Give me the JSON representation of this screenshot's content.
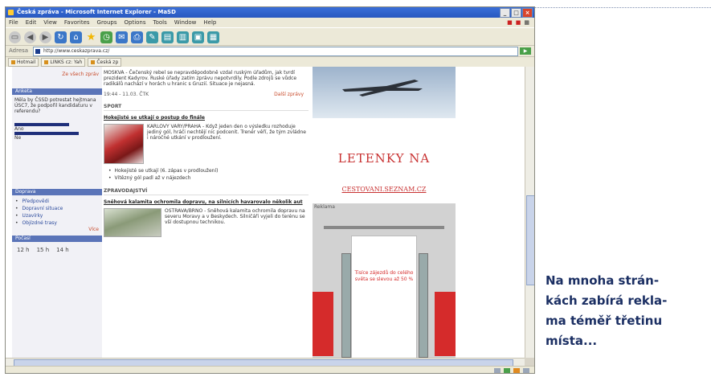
{
  "window": {
    "title": "Česká zpráva - Microsoft Internet Explorer - MaSD",
    "menu": [
      "File",
      "Edit",
      "View",
      "Favorites",
      "Groups",
      "Options",
      "Tools",
      "Window",
      "Help"
    ]
  },
  "address": {
    "label": "Adresa",
    "url": "http://www.ceskazprava.cz/"
  },
  "links": [
    "Hotmail",
    "LINKS cz: Yah",
    "Česká zp"
  ],
  "left_column": {
    "top_link": "Ze všech zpráv",
    "poll_title": "Anketa",
    "poll_question": "Měla by ČSSD potrestat hejtmana ÚSC7, že podpořil kandidaturu v referendu?",
    "poll_options": [
      {
        "label": "Ano",
        "value": 0.68
      },
      {
        "label": "Ne",
        "value": 0.8
      }
    ],
    "services_title": "Doprava",
    "services": [
      "Předpovědi",
      "Dopravní situace",
      "Uzavírky",
      "Objízdné trasy"
    ],
    "services_more": "Více",
    "weather_title": "Počasí",
    "weather": [
      "12 h",
      "15 h",
      "14 h"
    ]
  },
  "middle": {
    "lead": "MOSKVA - Čečenský rebel se nepravděpodobně vzdal ruským úřadům, jak tvrdí prezident Kadyrov. Ruské úřady zatím zprávu nepotvrdily. Podle zdrojů se vůdce radikálů nachází v horách u hranic s Gruzií. Situace je nejasná.",
    "time": "19:44 - 11.03. ČTK",
    "more": "Další zprávy",
    "section_sport": "SPORT",
    "sport_headline": "Hokejisté se utkají o postup do finále",
    "sport_text": "KARLOVY VARY/PRAHA - Když jeden den o výsledku rozhoduje jediný gól, hráči nechtějí nic podcenit. Trenér věří, že tým zvládne i náročné utkání v prodloužení.",
    "sport_links": [
      "Hokejisté se utkají (6. zápas v prodloužení)",
      "Vítězný gól padl až v nájezdech"
    ],
    "section_domestic": "ZPRAVODAJSTVÍ",
    "domestic_headline": "Sněhová kalamita ochromila dopravu, na silnicích havarovalo několik aut",
    "domestic_text": "OSTRAVA/BRNO - Sněhová kalamita ochromila dopravu na severu Moravy a v Beskydech. Silničáři vyjeli do terénu se vší dostupnou technikou."
  },
  "ad": {
    "headline": "LETENKY NA",
    "domain": "CESTOVANI.SEZNAM.CZ",
    "label": "Reklama",
    "card_text": "Tisíce zájezdů do celého světa se slevou až 50 %"
  },
  "caption": {
    "lines": [
      "Na mnoha strán-",
      "kách zabírá rekla-",
      "ma téměř třetinu",
      "místa..."
    ]
  },
  "colors": {
    "accent_blue": "#1b2f63",
    "ad_red": "#c83232",
    "section_header": "#5a74b8"
  }
}
